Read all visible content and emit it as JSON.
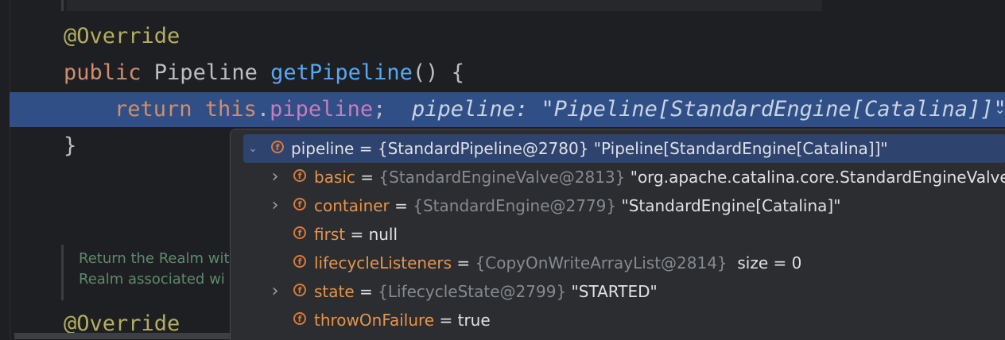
{
  "editor": {
    "code_lines": [
      {
        "id": "override-1",
        "tokens": [
          {
            "t": "@Override",
            "c": "ann"
          }
        ]
      },
      {
        "id": "method-signature",
        "tokens": [
          {
            "t": "public ",
            "c": "kw"
          },
          {
            "t": "Pipeline ",
            "c": "plain"
          },
          {
            "t": "getPipeline",
            "c": "fn"
          },
          {
            "t": "() {",
            "c": "plain"
          }
        ]
      },
      {
        "id": "return-line",
        "tokens": [
          {
            "t": "return ",
            "c": "kw"
          },
          {
            "t": "this",
            "c": "kw"
          },
          {
            "t": ".",
            "c": "plain"
          },
          {
            "t": "pipeline",
            "c": "fld"
          },
          {
            "t": ";",
            "c": "plain"
          }
        ]
      },
      {
        "id": "closing-brace",
        "tokens": [
          {
            "t": "}",
            "c": "plain"
          }
        ]
      },
      {
        "id": "override-2",
        "tokens": [
          {
            "t": "@Override",
            "c": "ann"
          }
        ]
      }
    ],
    "inline_value_hint": "pipeline: \"Pipeline[StandardEngine[Catalina]]\"",
    "hint_chevron": "⌄",
    "doc_comment_lines": [
      "Return the Realm wit",
      "Realm associated wi"
    ]
  },
  "popup": {
    "rows": [
      {
        "name": "pipeline",
        "sep": " = ",
        "ref": "{StandardPipeline@2780}",
        "value": " \"Pipeline[StandardEngine[Catalina]]\"",
        "expand": "expanded",
        "selected": true,
        "depth": 0,
        "ref_dim": false
      },
      {
        "name": "basic",
        "sep": " = ",
        "ref": "{StandardEngineValve@2813}",
        "value": " \"org.apache.catalina.core.StandardEngineValve[C",
        "expand": "collapsed",
        "selected": false,
        "depth": 1,
        "ref_dim": true
      },
      {
        "name": "container",
        "sep": " = ",
        "ref": "{StandardEngine@2779}",
        "value": " \"StandardEngine[Catalina]\"",
        "expand": "collapsed",
        "selected": false,
        "depth": 1,
        "ref_dim": true
      },
      {
        "name": "first",
        "sep": " = ",
        "ref": "",
        "value": "null",
        "expand": "none",
        "selected": false,
        "depth": 1,
        "ref_dim": true
      },
      {
        "name": "lifecycleListeners",
        "sep": " = ",
        "ref": "{CopyOnWriteArrayList@2814}",
        "value": "  size = 0",
        "expand": "none",
        "selected": false,
        "depth": 1,
        "ref_dim": true
      },
      {
        "name": "state",
        "sep": " = ",
        "ref": "{LifecycleState@2799}",
        "value": " \"STARTED\"",
        "expand": "collapsed",
        "selected": false,
        "depth": 1,
        "ref_dim": true
      },
      {
        "name": "throwOnFailure",
        "sep": " = ",
        "ref": "",
        "value": "true",
        "expand": "none",
        "selected": false,
        "depth": 1,
        "ref_dim": true
      }
    ],
    "field_badge": "f",
    "chevron_expanded": "⌄",
    "chevron_collapsed": "›"
  },
  "colors": {
    "exec_highlight": "#2f4f86",
    "popup_selected": "#2e436e",
    "field_badge": "#d97a3a"
  }
}
